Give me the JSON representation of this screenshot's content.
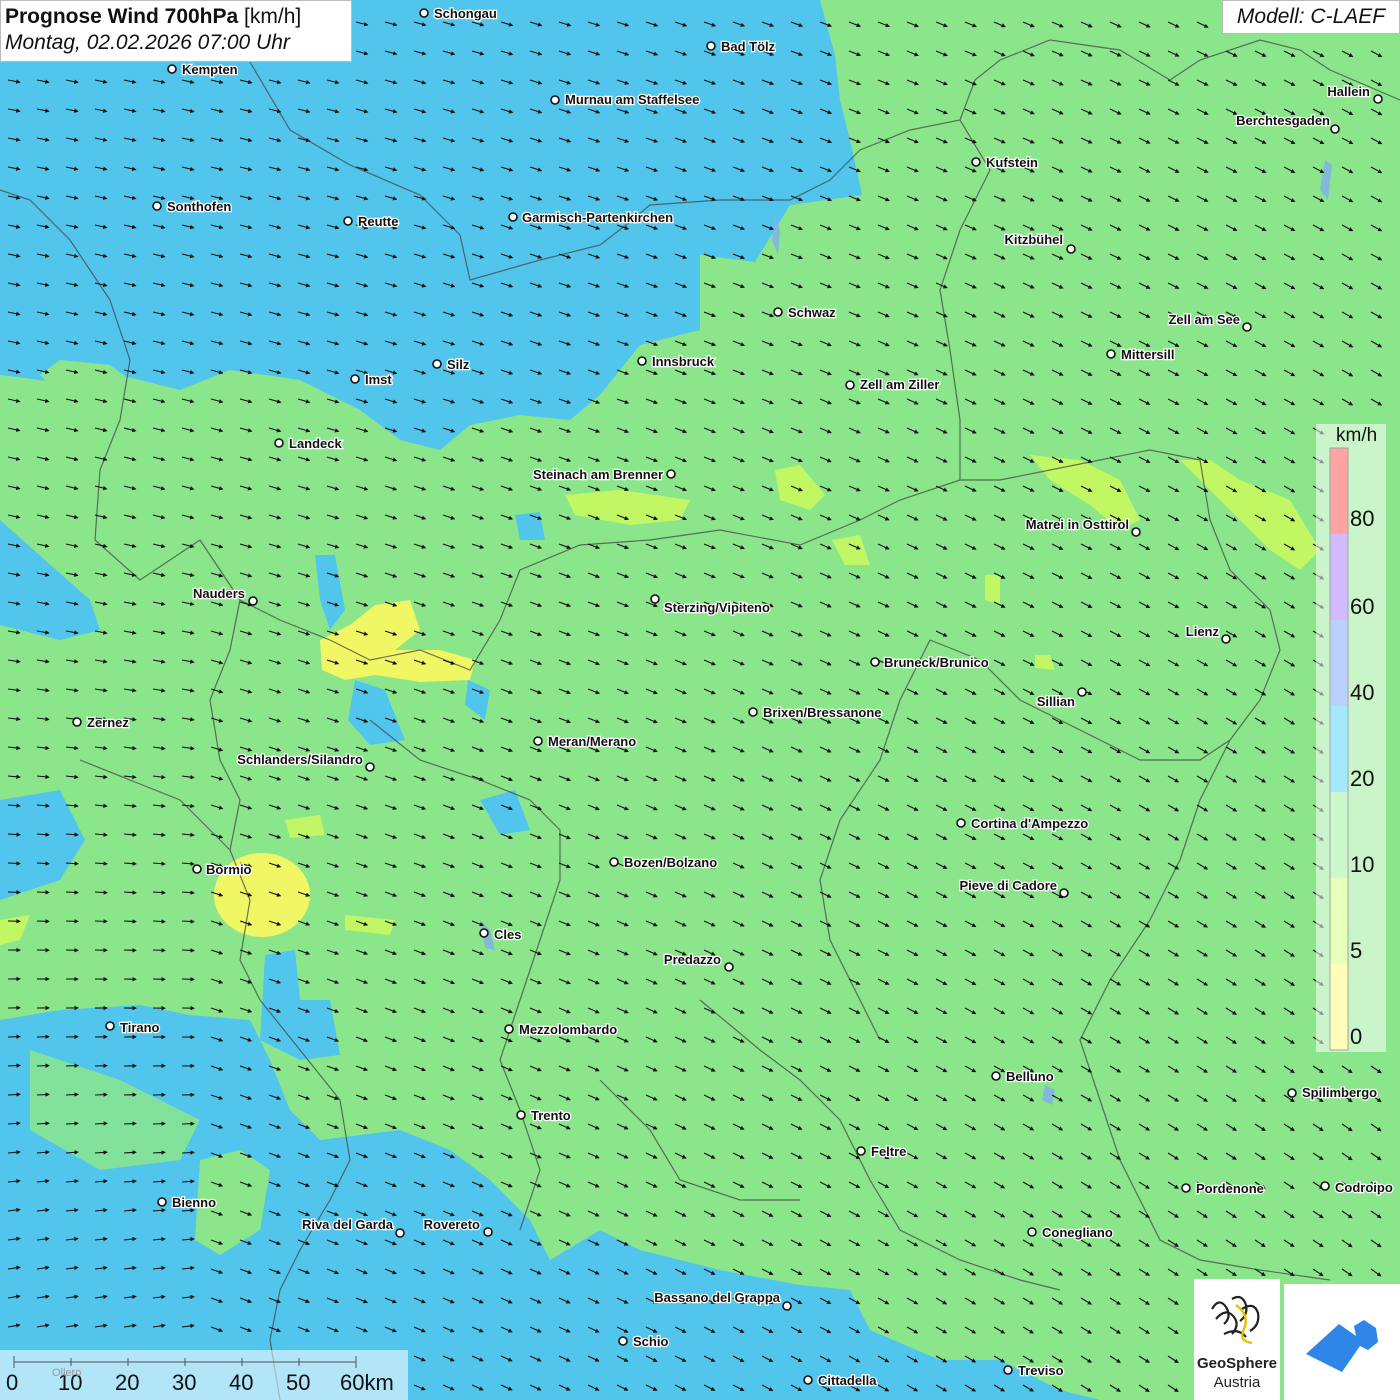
{
  "header": {
    "title_bold": "Prognose Wind 700hPa",
    "title_unit": "[km/h]",
    "datetime": "Montag, 02.02.2026 07:00 Uhr",
    "model": "Modell: C-LAEF"
  },
  "legend": {
    "unit": "km/h",
    "bands": [
      {
        "from": 0,
        "to": 5,
        "color": "#ffff66"
      },
      {
        "from": 5,
        "to": 10,
        "color": "#ccff66"
      },
      {
        "from": 10,
        "to": 20,
        "color": "#90ee90"
      },
      {
        "from": 20,
        "to": 40,
        "color": "#33ccff"
      },
      {
        "from": 40,
        "to": 60,
        "color": "#6699ff"
      },
      {
        "from": 60,
        "to": 80,
        "color": "#9966ff"
      },
      {
        "from": 80,
        "to": 100,
        "color": "#ff3333"
      }
    ],
    "tick_labels": [
      "80",
      "60",
      "40",
      "20",
      "10",
      "5",
      "0"
    ]
  },
  "scalebar": {
    "labels": [
      "0",
      "10",
      "20",
      "30",
      "40",
      "50",
      "60km"
    ],
    "faint_label": "Ollero"
  },
  "logos": {
    "geosphere_line1": "GeoSphere",
    "geosphere_line2": "Austria"
  },
  "colors": {
    "wind_low": "#ffff66",
    "wind_mid": "#90ee90",
    "wind_high": "#55ccf5",
    "borders": "#444444",
    "arrows": "#111111"
  },
  "cities": [
    {
      "name": "Schongau"
    },
    {
      "name": "Bad Tölz"
    },
    {
      "name": "Kempten"
    },
    {
      "name": "Murnau am Staffelsee"
    },
    {
      "name": "Hallein"
    },
    {
      "name": "Berchtesgaden"
    },
    {
      "name": "Kufstein"
    },
    {
      "name": "Sonthofen"
    },
    {
      "name": "Reutte"
    },
    {
      "name": "Garmisch-Partenkirchen"
    },
    {
      "name": "Kitzbühel"
    },
    {
      "name": "Schwaz"
    },
    {
      "name": "Zell am See"
    },
    {
      "name": "Mittersill"
    },
    {
      "name": "Innsbruck"
    },
    {
      "name": "Imst"
    },
    {
      "name": "Silz"
    },
    {
      "name": "Zell am Ziller"
    },
    {
      "name": "Landeck"
    },
    {
      "name": "Steinach am Brenner"
    },
    {
      "name": "Matrei in Osttirol"
    },
    {
      "name": "Nauders"
    },
    {
      "name": "Sterzing/Vipiteno"
    },
    {
      "name": "Lienz"
    },
    {
      "name": "Bruneck/Brunico"
    },
    {
      "name": "Sillian"
    },
    {
      "name": "Zernez"
    },
    {
      "name": "Brixen/Bressanone"
    },
    {
      "name": "Meran/Merano"
    },
    {
      "name": "Schlanders/Silandro"
    },
    {
      "name": "Cortina d'Ampezzo"
    },
    {
      "name": "Bormio"
    },
    {
      "name": "Bozen/Bolzano"
    },
    {
      "name": "Pieve di Cadore"
    },
    {
      "name": "Cles"
    },
    {
      "name": "Predazzo"
    },
    {
      "name": "Tirano"
    },
    {
      "name": "Mezzolombardo"
    },
    {
      "name": "Belluno"
    },
    {
      "name": "Spilimbergo"
    },
    {
      "name": "Trento"
    },
    {
      "name": "Feltre"
    },
    {
      "name": "Bienno"
    },
    {
      "name": "Pordenone"
    },
    {
      "name": "Codroipo"
    },
    {
      "name": "Riva del Garda"
    },
    {
      "name": "Rovereto"
    },
    {
      "name": "Conegliano"
    },
    {
      "name": "Bassano del Grappa"
    },
    {
      "name": "Schio"
    },
    {
      "name": "Treviso"
    },
    {
      "name": "Cittadella"
    }
  ]
}
